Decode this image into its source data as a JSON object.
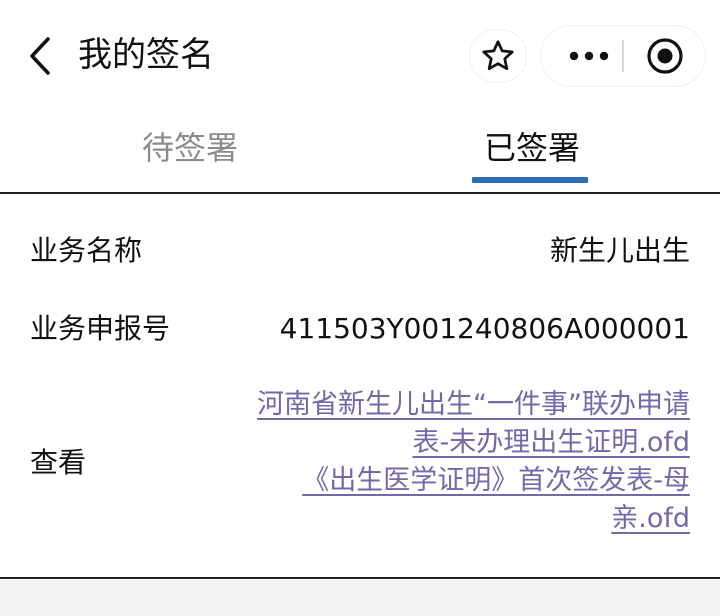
{
  "header": {
    "title": "我的签名",
    "icons": {
      "back": "chevron-left-icon",
      "favorite": "star-icon",
      "more": "more-dots-icon",
      "target": "target-icon"
    }
  },
  "tabs": [
    {
      "label": "待签署",
      "active": false
    },
    {
      "label": "已签署",
      "active": true
    }
  ],
  "record": {
    "name_label": "业务名称",
    "name_value": "新生儿出生",
    "number_label": "业务申报号",
    "number_value": "411503Y001240806A000001",
    "view_label": "查看",
    "files": [
      {
        "line1": "河南省新生儿出生“一件事”联办申请",
        "line2": "表-未办理出生证明.ofd"
      },
      {
        "line1": "《出生医学证明》首次签发表-母",
        "line2": "亲.ofd"
      }
    ]
  },
  "colors": {
    "accent": "#2f6db5",
    "link": "#7269a8",
    "inactive_tab": "#8c8c8c"
  }
}
